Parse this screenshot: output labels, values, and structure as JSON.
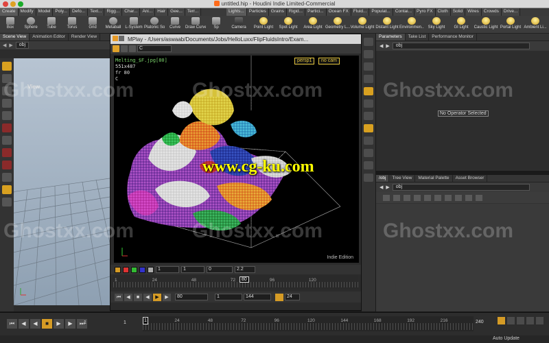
{
  "window": {
    "title": "untitled.hip - Houdini Indie Limited-Commercial"
  },
  "shelf": {
    "left_tabs": [
      "Create",
      "Modify",
      "Model",
      "Poly...",
      "Defo...",
      "Text...",
      "Rigg...",
      "Char...",
      "Ani...",
      "Hair",
      "Gee...",
      "Terr..."
    ],
    "right_tabs": [
      "Lights...",
      "Particles",
      "Grains",
      "Rigid...",
      "Partici...",
      "Ocean FX",
      "Fluid...",
      "Populat...",
      "Contai...",
      "Pyro FX",
      "Cloth",
      "Solid",
      "Wires",
      "Crowds",
      "Drive..."
    ],
    "left_tools": [
      "Box",
      "Sphere",
      "Tube",
      "Torus",
      "Grid",
      "Metaball",
      "L-System",
      "Platonic Sol...",
      "Curve",
      "Draw Curve",
      "Sp"
    ],
    "right_tools": [
      "Camera",
      "Point Light",
      "Spot Light",
      "Area Light",
      "Geometry L...",
      "Volume Light",
      "Distant Light",
      "Environmen...",
      "Sky Light",
      "GI Light",
      "Caustic Light",
      "Portal Light",
      "Ambient Li..."
    ]
  },
  "left_panel": {
    "tabs": [
      "Scene View",
      "Animation Editor",
      "Render View"
    ],
    "path": "obj",
    "view_label": "View"
  },
  "mplay": {
    "title": "MPlay - /Users/aswaab/Documents/Jobs/HelloLuxx/FlipFluidsIntro/Exam...",
    "channel": "C",
    "info": {
      "name": "Melting_$F.jpg[80]",
      "res": "551x487",
      "frame": "fr 80",
      "channel": "C"
    },
    "persp": "persp1",
    "cam": "no cam",
    "edition": "Indie Edition",
    "controls": {
      "field1": "1",
      "field2": "1",
      "field3": "0",
      "gamma": "2.2"
    },
    "ruler_ticks": [
      "1",
      "24",
      "48",
      "72",
      "96",
      "120"
    ],
    "current_frame": "80",
    "play": {
      "frame": "80",
      "start": "1",
      "end": "144",
      "step": "24"
    }
  },
  "params": {
    "tabs": [
      "Parameters",
      "Take List",
      "Performance Monitor"
    ],
    "path": "obj",
    "empty_message": "No Operator Selected"
  },
  "network": {
    "tabs": [
      "/obj",
      "Tree View",
      "Material Palette",
      "Asset Browser"
    ],
    "path": "obj"
  },
  "timeline": {
    "start": "1",
    "start2": "1",
    "current": "1",
    "ticks": [
      "24",
      "48",
      "72",
      "96",
      "120",
      "144",
      "168",
      "192",
      "216"
    ],
    "end": "240",
    "auto_update": "Auto Update"
  },
  "watermarks": {
    "brand": "Ghostxx.com",
    "site": "www.cg-ku.com"
  },
  "colors": {
    "accent": "#d59b25",
    "mplay_bg": "#000000",
    "persp_label": "#e8c840"
  }
}
